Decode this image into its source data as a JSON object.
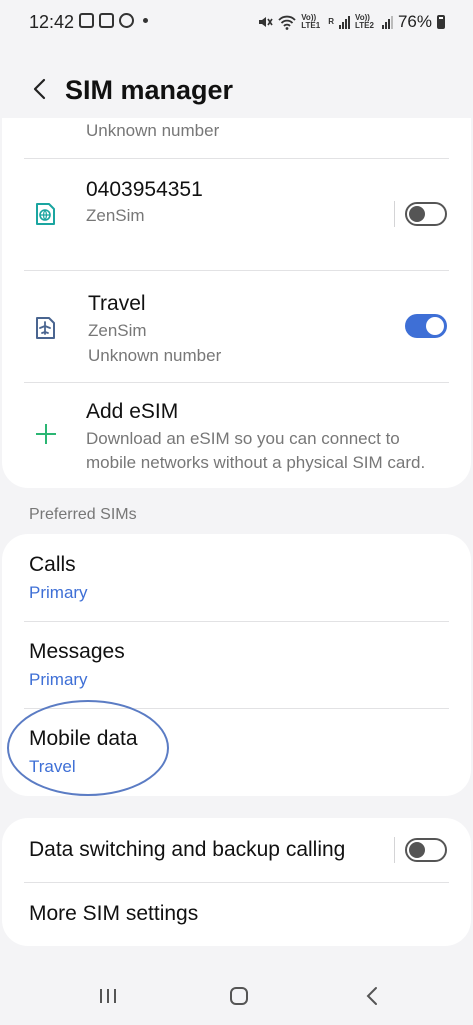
{
  "status_bar": {
    "time": "12:42",
    "network_label_1": "Vo)) LTE1",
    "roaming_label": "R",
    "network_label_2": "Vo)) LTE2",
    "battery": "76%"
  },
  "header": {
    "title": "SIM manager"
  },
  "sims": {
    "partial_item": {
      "number": "Unknown number"
    },
    "items": [
      {
        "name": "0403954351",
        "carrier": "ZenSim",
        "number": "",
        "enabled": false,
        "icon": "globe-sim-icon"
      },
      {
        "name": "Travel",
        "carrier": "ZenSim",
        "number": "Unknown number",
        "enabled": true,
        "icon": "airplane-sim-icon"
      }
    ],
    "add_esim": {
      "label": "Add eSIM",
      "description_line1": "Download an eSIM so you can connect to",
      "description_line2": "mobile networks without a physical SIM card.",
      "icon": "plus-icon"
    }
  },
  "preferred": {
    "section_label": "Preferred SIMs",
    "items": [
      {
        "label": "Calls",
        "value": "Primary"
      },
      {
        "label": "Messages",
        "value": "Primary"
      },
      {
        "label": "Mobile data",
        "value": "Travel"
      }
    ]
  },
  "more": {
    "data_switching_label": "Data switching and backup calling",
    "data_switching_enabled": false,
    "more_settings_label": "More SIM settings"
  },
  "colors": {
    "accent": "#3e6fd6",
    "esim_plus": "#2bb673",
    "sim_icon_teal": "#1aa5a0",
    "sim_icon_slate": "#4a6590",
    "annotation": "#5b7cc4"
  }
}
